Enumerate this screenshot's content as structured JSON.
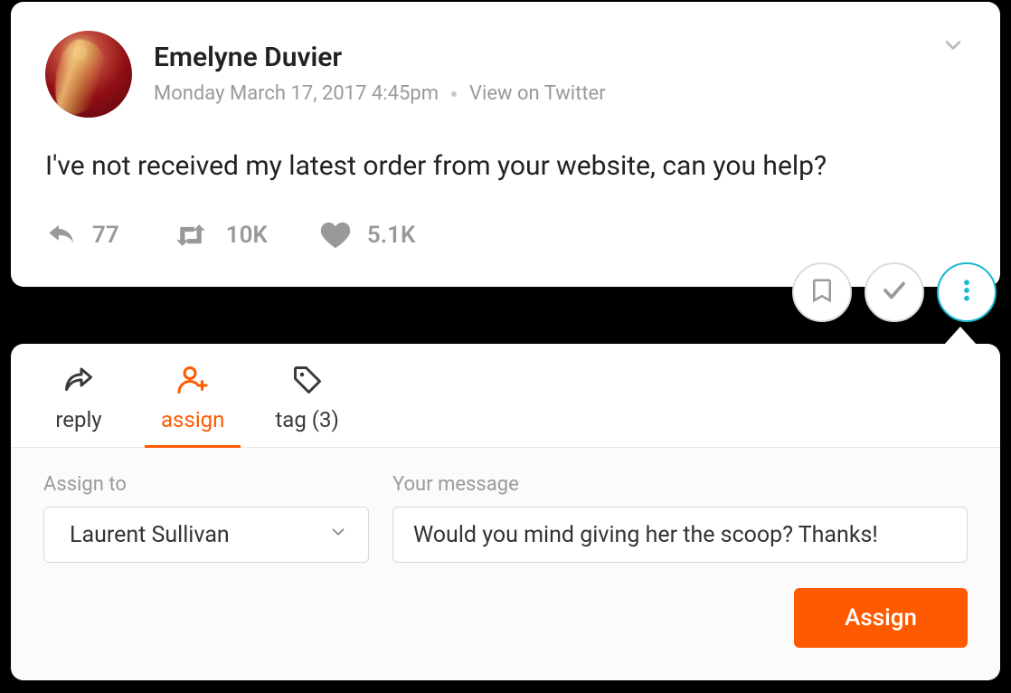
{
  "post": {
    "author_name": "Emelyne Duvier",
    "timestamp": "Monday March 17, 2017  4:45pm",
    "view_on_source": "View on Twitter",
    "body": "I've not received my latest order from your website, can you help?",
    "stats": {
      "replies": "77",
      "retweets": "10K",
      "likes": "5.1K"
    }
  },
  "tabs": {
    "reply_label": "reply",
    "assign_label": "assign",
    "tag_label": "tag (3)"
  },
  "assign_form": {
    "assign_to_label": "Assign to",
    "assign_to_value": "Laurent Sullivan",
    "message_label": "Your message",
    "message_value": "Would you mind giving her the scoop? Thanks!",
    "submit_label": "Assign"
  }
}
